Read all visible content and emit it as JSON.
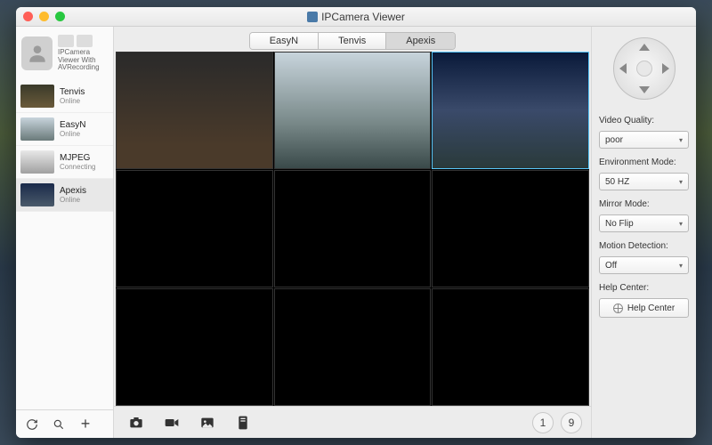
{
  "window": {
    "title": "IPCamera Viewer"
  },
  "sidebar": {
    "caption": "IPCamera Viewer With AVRecording",
    "cameras": [
      {
        "name": "Tenvis",
        "status": "Online"
      },
      {
        "name": "EasyN",
        "status": "Online"
      },
      {
        "name": "MJPEG",
        "status": "Connecting"
      },
      {
        "name": "Apexis",
        "status": "Online"
      }
    ],
    "selected_index": 3
  },
  "tabs": {
    "items": [
      "EasyN",
      "Tenvis",
      "Apexis"
    ],
    "active_index": 2
  },
  "grid": {
    "rows": 3,
    "cols": 3,
    "selected_index": 2,
    "active_feeds": [
      0,
      1,
      2
    ]
  },
  "bottombar": {
    "layout_options": [
      "1",
      "9"
    ]
  },
  "settings": {
    "video_quality": {
      "label": "Video Quality:",
      "value": "poor"
    },
    "environment_mode": {
      "label": "Environment Mode:",
      "value": "50 HZ"
    },
    "mirror_mode": {
      "label": "Mirror Mode:",
      "value": "No Flip"
    },
    "motion_detection": {
      "label": "Motion Detection:",
      "value": "Off"
    },
    "help_center": {
      "label": "Help Center:",
      "button": "Help Center"
    }
  }
}
